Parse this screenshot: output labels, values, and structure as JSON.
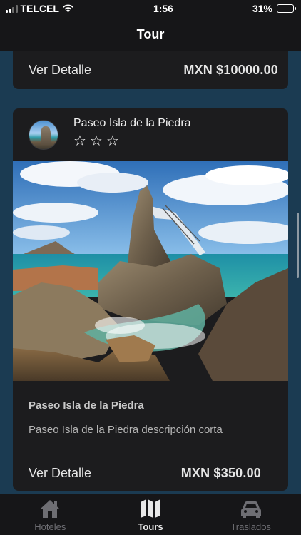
{
  "status_bar": {
    "carrier": "TELCEL",
    "time": "1:56",
    "battery": "31%"
  },
  "header": {
    "title": "Tour"
  },
  "previous_card": {
    "detail_link": "Ver Detalle",
    "price": "MXN $10000.00"
  },
  "tour_card": {
    "name": "Paseo Isla de la Piedra",
    "stars": [
      "☆",
      "☆",
      "☆"
    ],
    "body_title": "Paseo Isla de la Piedra",
    "short_description": "Paseo Isla de la Piedra descripción corta",
    "detail_link": "Ver Detalle",
    "price": "MXN $350.00",
    "photo_icon": "rock-arch-photo"
  },
  "tab_bar": {
    "tabs": [
      {
        "label": "Hoteles",
        "icon": "house-icon",
        "active": false
      },
      {
        "label": "Tours",
        "icon": "map-icon",
        "active": true
      },
      {
        "label": "Traslados",
        "icon": "car-icon",
        "active": false
      }
    ]
  },
  "colors": {
    "background": "#1b3b52",
    "card": "#1c1c1e",
    "bars": "#161618",
    "inactive_tab": "#6e6e73"
  }
}
